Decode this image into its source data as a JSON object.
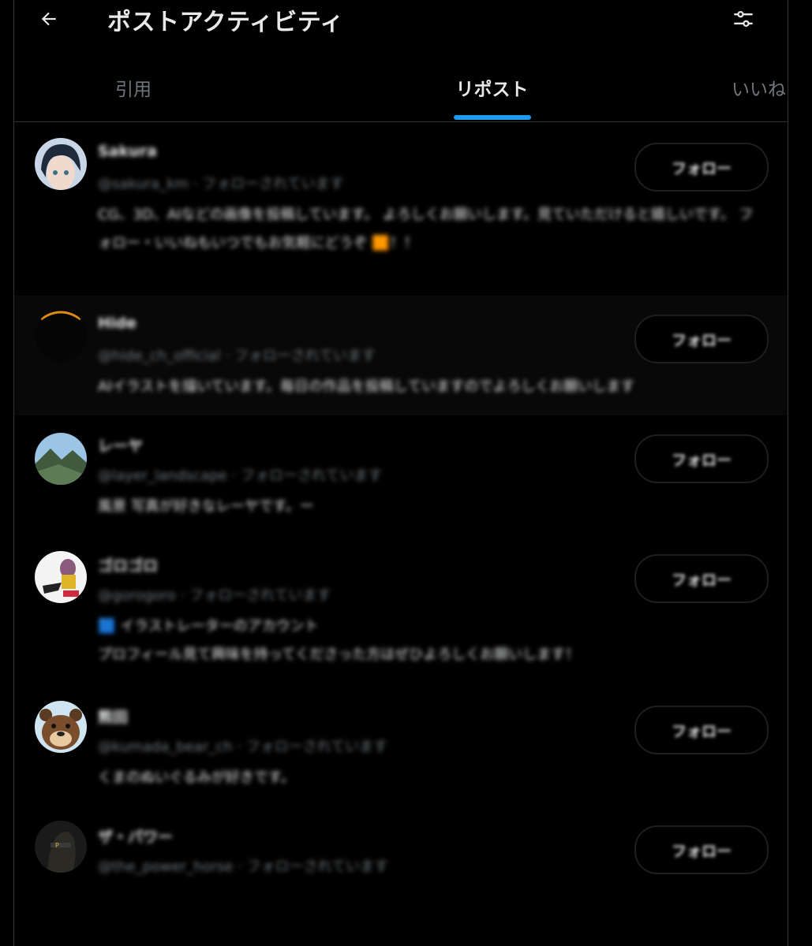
{
  "header": {
    "title": "ポストアクティビティ",
    "back_icon": "arrow-left-icon",
    "filter_icon": "sliders-icon"
  },
  "tabs": [
    {
      "label": "引用",
      "active": false
    },
    {
      "label": "リポスト",
      "active": true
    },
    {
      "label": "いいね",
      "active": false
    }
  ],
  "accent_color": "#1d9bf0",
  "users": [
    {
      "name": "Sakura",
      "handle": "@sakura_km · フォローされています",
      "bio": "CG、3D、AIなどの画像を投稿しています。 よろしくお願いします。見ていただけると嬉しいです。 フォロー・いいねもいつでもお気軽にどうぞ 🟧！！",
      "follow_label": "フォロー"
    },
    {
      "name": "Hide",
      "handle": "@hide_ch_official · フォローされています",
      "bio": "AIイラストを描いています。毎日の作品を投稿していますのでよろしくお願いします",
      "follow_label": "フォロー"
    },
    {
      "name": "レーヤ",
      "handle": "@layer_landscape · フォローされています",
      "bio": "風景 写真が好きなレーヤです。ー",
      "follow_label": "フォロー"
    },
    {
      "name": "ゴロゴロ",
      "handle": "@gorogoro · フォローされています",
      "bio": "🟦 イラストレーターのアカウント\nプロフィール見て興味を持ってくださった方はぜひよろしくお願いします！",
      "follow_label": "フォロー"
    },
    {
      "name": "熊田",
      "handle": "@kumada_bear_ch · フォローされています",
      "bio": "くまのぬいぐるみが好きです。",
      "follow_label": "フォロー"
    },
    {
      "name": "ザ・パワー",
      "handle": "@the_power_horse · フォローされています",
      "bio": "",
      "follow_label": "フォロー"
    }
  ]
}
